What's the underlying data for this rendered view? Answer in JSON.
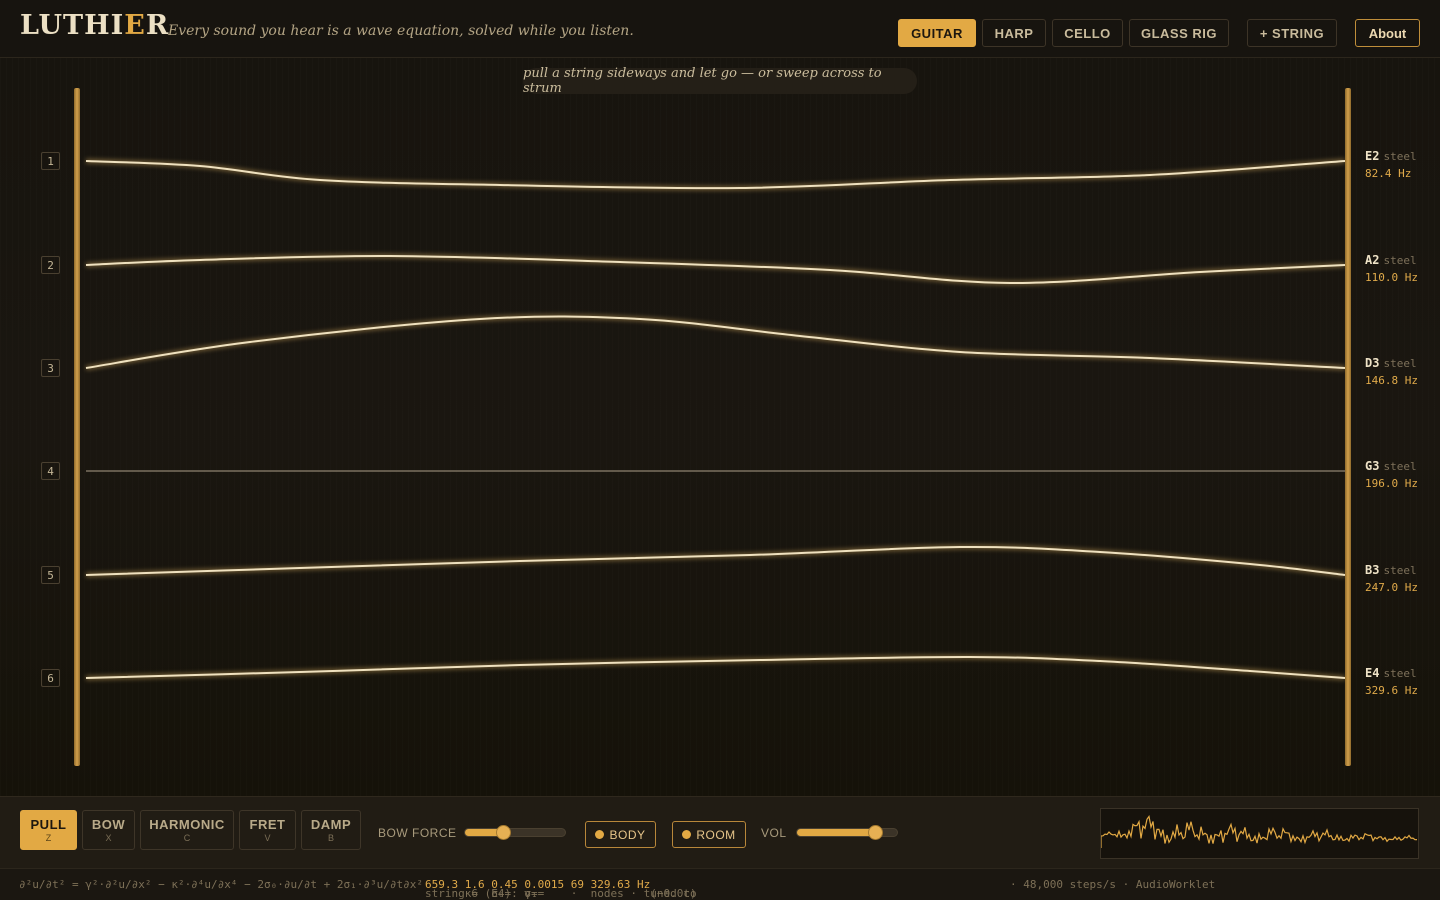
{
  "header": {
    "logo_main": "LUTHI",
    "logo_accent": "E",
    "logo_tail": "R",
    "tagline": "Every sound you hear is a wave equation, solved while you listen.",
    "instruments": [
      {
        "label": "GUITAR",
        "active": true
      },
      {
        "label": "HARP",
        "active": false
      },
      {
        "label": "CELLO",
        "active": false
      },
      {
        "label": "GLASS RIG",
        "active": false
      }
    ],
    "add_string_label": "+ STRING",
    "about_label": "About"
  },
  "stage": {
    "hint": "pull a string sideways and let go — or sweep across to strum",
    "strings": [
      {
        "number": "1",
        "note": "E2",
        "material": "steel",
        "freq": "82.4 Hz"
      },
      {
        "number": "2",
        "note": "A2",
        "material": "steel",
        "freq": "110.0 Hz"
      },
      {
        "number": "3",
        "note": "D3",
        "material": "steel",
        "freq": "146.8 Hz"
      },
      {
        "number": "4",
        "note": "G3",
        "material": "steel",
        "freq": "196.0 Hz"
      },
      {
        "number": "5",
        "note": "B3",
        "material": "steel",
        "freq": "247.0 Hz"
      },
      {
        "number": "6",
        "note": "E4",
        "material": "steel",
        "freq": "329.6 Hz"
      }
    ]
  },
  "controls": {
    "modes": [
      {
        "label": "PULL",
        "key": "Z",
        "active": true
      },
      {
        "label": "BOW",
        "key": "X",
        "active": false
      },
      {
        "label": "HARMONIC",
        "key": "C",
        "active": false
      },
      {
        "label": "FRET",
        "key": "V",
        "active": false
      },
      {
        "label": "DAMP",
        "key": "B",
        "active": false
      }
    ],
    "bow_force_label": "BOW FORCE",
    "bow_force_value": 0.38,
    "body_label": "BODY",
    "room_label": "ROOM",
    "vol_label": "VOL",
    "vol_value": 0.78
  },
  "status": {
    "equation": "∂²u/∂t² = γ²·∂²u/∂x² − κ²·∂⁴u/∂x⁴ − 2σ₀·∂u/∂t + 2σ₁·∂³u/∂t∂x²",
    "string_prefix": "string 6 (E4): γ=",
    "gamma": "659.3",
    "kappa_label": "κ=",
    "kappa": "1.6",
    "sigma0_label": "σ₀=",
    "sigma0": "0.45",
    "sigma1_label": "σ₁=",
    "sigma1": "0.0015",
    "sep1": "·",
    "nodes": "69",
    "nodes_label": "nodes · tuned to",
    "tuned": "329.63 Hz",
    "cents": "(−0.0c)",
    "tail": "· 48,000 steps/s · AudioWorklet"
  },
  "colors": {
    "accent": "#e2a944",
    "background": "#15120d",
    "string": "#efe1bf"
  }
}
